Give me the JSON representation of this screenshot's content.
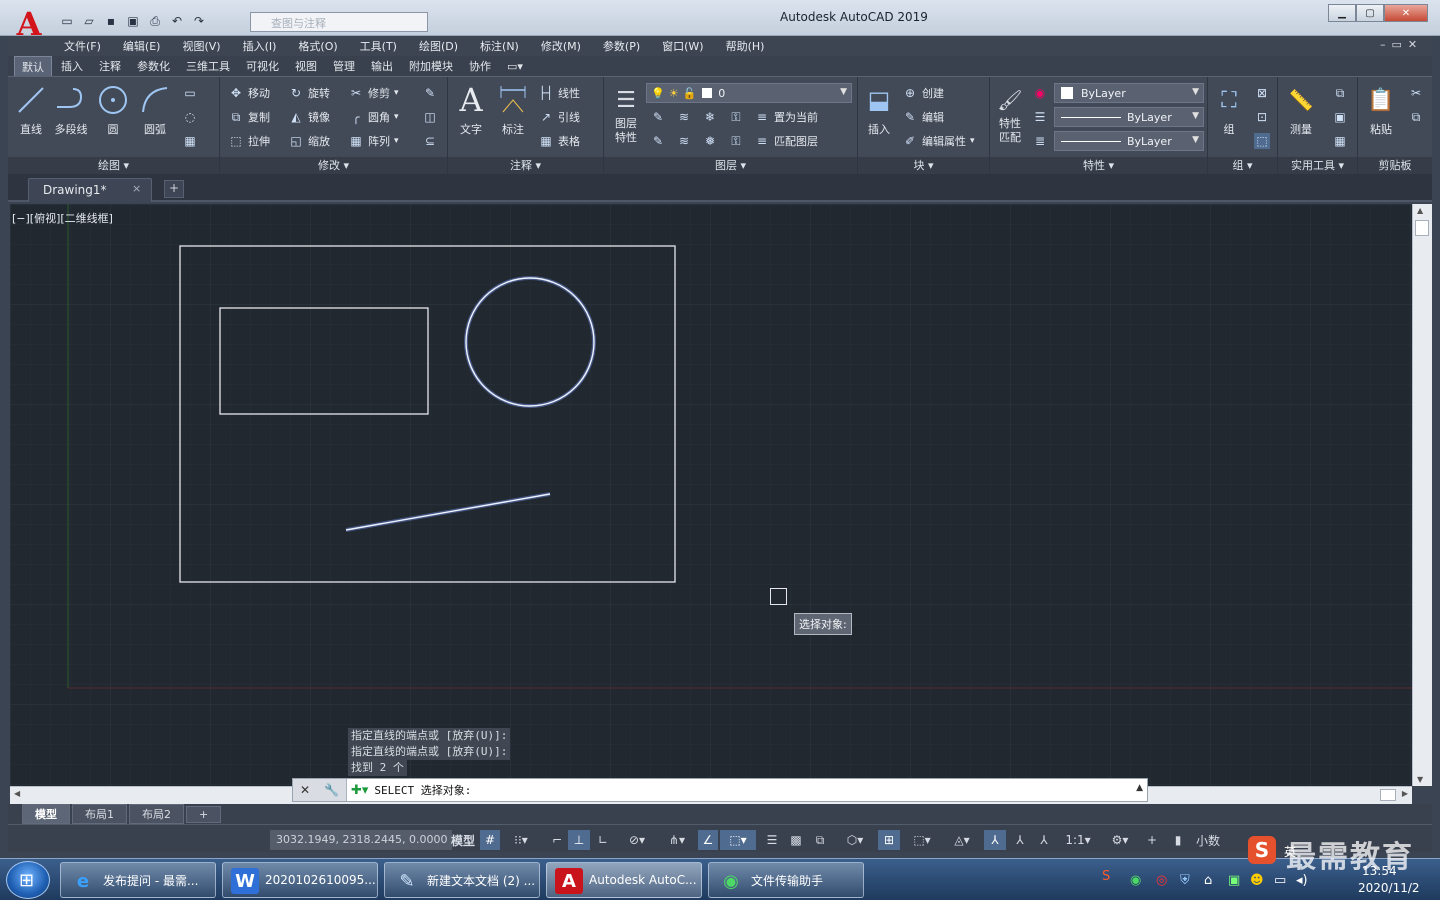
{
  "window": {
    "title": "Autodesk AutoCAD 2019",
    "app_letter": "A",
    "workspace_placeholder": "查图与注释"
  },
  "menu": [
    "文件(F)",
    "编辑(E)",
    "视图(V)",
    "插入(I)",
    "格式(O)",
    "工具(T)",
    "绘图(D)",
    "标注(N)",
    "修改(M)",
    "参数(P)",
    "窗口(W)",
    "帮助(H)"
  ],
  "ribbon_tabs": [
    "默认",
    "插入",
    "注释",
    "参数化",
    "三维工具",
    "可视化",
    "视图",
    "管理",
    "输出",
    "附加模块",
    "协作"
  ],
  "ribbon": {
    "draw": {
      "title": "绘图",
      "line": "直线",
      "polyline": "多段线",
      "circle": "圆",
      "arc": "圆弧"
    },
    "modify": {
      "title": "修改",
      "move": "移动",
      "rotate": "旋转",
      "trim": "修剪",
      "copy": "复制",
      "mirror": "镜像",
      "fillet": "圆角",
      "stretch": "拉伸",
      "scale": "缩放",
      "array": "阵列"
    },
    "annotation": {
      "title": "注释",
      "text": "文字",
      "dimension": "标注",
      "linear": "线性",
      "leader": "引线",
      "table": "表格"
    },
    "layers": {
      "title": "图层",
      "properties": "图层\n特性",
      "current_layer": "0",
      "set_current": "置为当前",
      "match_layer": "匹配图层"
    },
    "block": {
      "title": "块",
      "insert": "插入",
      "create": "创建",
      "edit": "编辑",
      "edit_attr": "编辑属性"
    },
    "properties": {
      "title": "特性",
      "match": "特性\n匹配",
      "color": "ByLayer",
      "linetype": "ByLayer",
      "lineweight": "ByLayer"
    },
    "groups": {
      "title": "组",
      "group": "组"
    },
    "utilities": {
      "title": "实用工具",
      "measure": "测量"
    },
    "clipboard": {
      "title": "剪贴板",
      "paste": "粘贴"
    }
  },
  "file_tab": {
    "name": "Drawing1*",
    "close": "×",
    "new": "+"
  },
  "viewport_label": "[−][俯视][二维线框]",
  "command": {
    "history": [
      "指定直线的端点或 [放弃(U)]:",
      "指定直线的端点或 [放弃(U)]:",
      "找到 2 个"
    ],
    "prompt": "SELECT 选择对象:",
    "tooltip": "选择对象:"
  },
  "layout_tabs": [
    "模型",
    "布局1",
    "布局2"
  ],
  "status": {
    "coords": "3032.1949, 2318.2445, 0.0000",
    "model": "模型",
    "scale": "1:1",
    "units": "小数"
  },
  "taskbar": {
    "items": [
      {
        "label": "发布提问 - 最需...",
        "icon": "ie-icon"
      },
      {
        "label": "2020102610095...",
        "icon": "wps-icon"
      },
      {
        "label": "新建文本文档 (2) ...",
        "icon": "notepad-icon"
      },
      {
        "label": "Autodesk AutoC...",
        "icon": "autocad-icon"
      },
      {
        "label": "文件传输助手",
        "icon": "wechat-icon"
      }
    ],
    "ime": "英",
    "time": "13:54",
    "date": "2020/11/2"
  },
  "watermark": "最需教育",
  "watermark_s": "S",
  "colors": {
    "canvas": "#212830",
    "accent": "#4f6b8f",
    "acad_red": "#d3141b"
  }
}
